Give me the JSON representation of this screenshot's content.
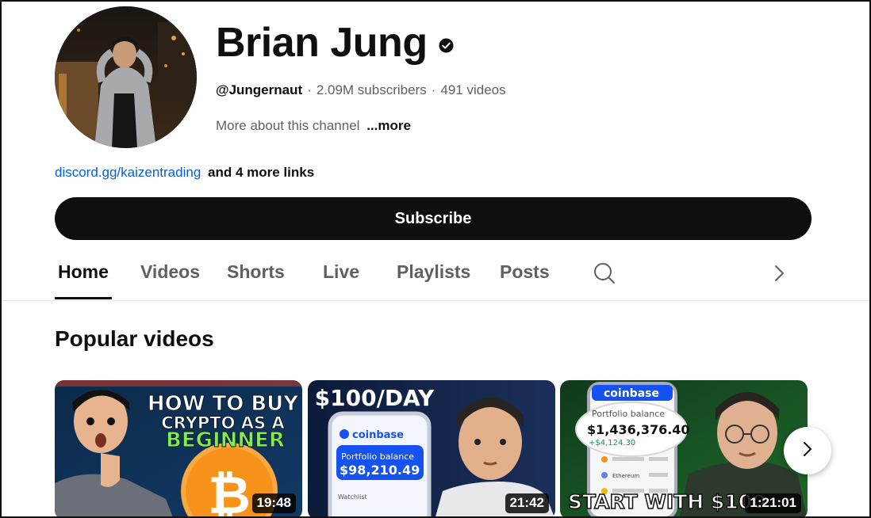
{
  "channel": {
    "name": "Brian Jung",
    "handle": "@Jungernaut",
    "separator": "·",
    "subscribers": "2.09M subscribers",
    "videos": "491 videos",
    "about_text": "More about this channel",
    "about_more": "...more",
    "link_text": "discord.gg/kaizentrading",
    "more_links": "and 4 more links",
    "subscribe_label": "Subscribe"
  },
  "tabs": [
    "Home",
    "Videos",
    "Shorts",
    "Live",
    "Playlists",
    "Posts"
  ],
  "icons": {
    "verified": "verified-check-icon",
    "search": "search-icon",
    "next": "chevron-right-icon"
  },
  "section": {
    "title": "Popular videos"
  },
  "videos": [
    {
      "duration": "19:48",
      "overlay_lines": [
        "HOW TO BUY",
        "CRYPTO AS A",
        "BEGINNER"
      ],
      "symbol": "₿"
    },
    {
      "duration": "21:42",
      "overlay_title": "$100/DAY",
      "app": "coinbase",
      "balance_label": "Portfolio balance",
      "balance": "$98,210.49",
      "list_label": "Watchlist"
    },
    {
      "duration": "1:21:01",
      "app": "coinbase",
      "balance_label": "Portfolio balance",
      "balance": "$1,436,376.40",
      "change": "+$4,124.30",
      "asset": "Ethereum",
      "caption": "START WITH $100"
    }
  ],
  "colors": {
    "link": "#065fd4",
    "text": "#0f0f0f",
    "secondary": "#606060",
    "button": "#0f0f0f",
    "coinbase": "#1652f0"
  }
}
